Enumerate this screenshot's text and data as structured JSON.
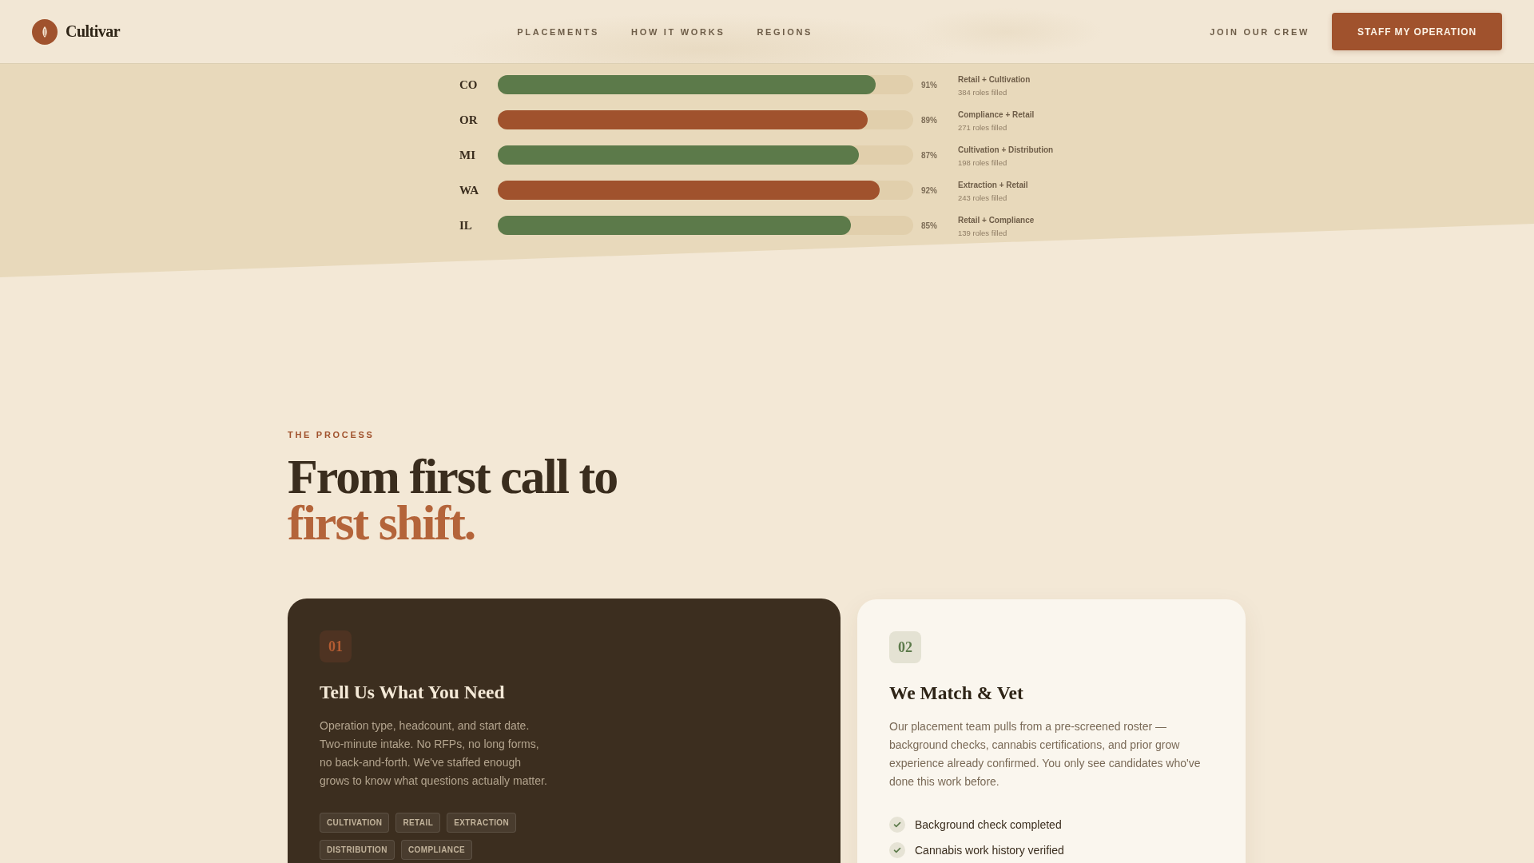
{
  "header": {
    "brand": "Cultivar",
    "nav": [
      "PLACEMENTS",
      "HOW IT WORKS",
      "REGIONS"
    ],
    "secondary_link": "JOIN OUR CREW",
    "cta": "STAFF MY OPERATION"
  },
  "regions": [
    {
      "state": "CO",
      "level": 0.91,
      "reading": "91%",
      "color": "#5c7a4a",
      "roles": "Retail + Cultivation",
      "filled": "384 roles filled"
    },
    {
      "state": "OR",
      "level": 0.89,
      "reading": "89%",
      "color": "#a0522d",
      "roles": "Compliance + Retail",
      "filled": "271 roles filled"
    },
    {
      "state": "MI",
      "level": 0.87,
      "reading": "87%",
      "color": "#5c7a4a",
      "roles": "Cultivation + Distribution",
      "filled": "198 roles filled"
    },
    {
      "state": "WA",
      "level": 0.92,
      "reading": "92%",
      "color": "#a0522d",
      "roles": "Extraction + Retail",
      "filled": "243 roles filled"
    },
    {
      "state": "IL",
      "level": 0.85,
      "reading": "85%",
      "color": "#5c7a4a",
      "roles": "Retail + Compliance",
      "filled": "139 roles filled"
    }
  ],
  "process": {
    "eyebrow": "THE PROCESS",
    "title": "From first call to",
    "title_accent": "first shift.",
    "steps": [
      {
        "kind": "dark",
        "number": "01",
        "title": "Tell Us What You Need",
        "body": "Operation type, headcount, and start date. Two-minute intake. No RFPs, no long forms, no back-and-forth. We've staffed enough grows to know what questions actually matter.",
        "tags": [
          "CULTIVATION",
          "RETAIL",
          "EXTRACTION",
          "DISTRIBUTION",
          "COMPLIANCE"
        ]
      },
      {
        "kind": "light",
        "number": "02",
        "title": "We Match & Vet",
        "body": "Our placement team pulls from a pre-screened roster — background checks, cannabis certifications, and prior grow experience already confirmed. You only see candidates who've done this work before.",
        "checklist": [
          {
            "label": "Background check completed",
            "checked": true
          },
          {
            "label": "Cannabis work history verified",
            "checked": true
          }
        ]
      }
    ]
  }
}
